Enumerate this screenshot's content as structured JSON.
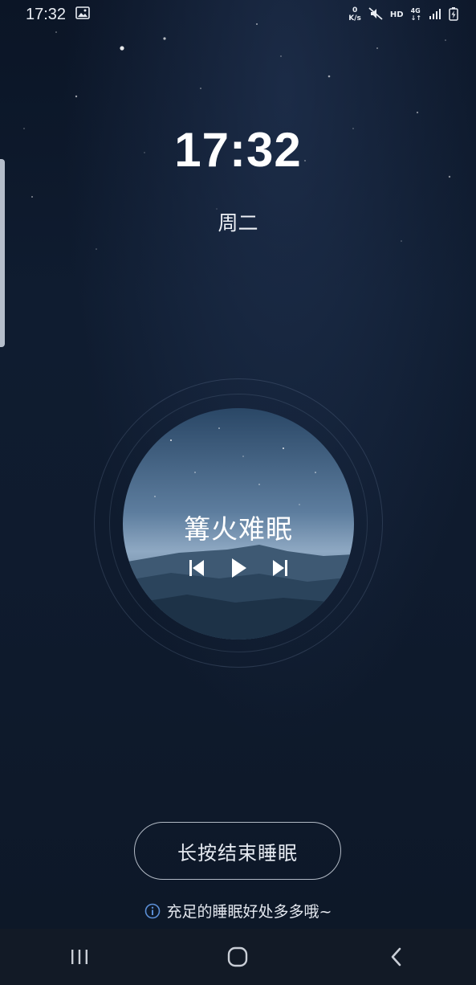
{
  "status_bar": {
    "time": "17:32",
    "net_speed_value": "0",
    "net_speed_unit": "K/s",
    "hd": "HD",
    "network": "4G",
    "icons": [
      "image-icon",
      "mute-icon",
      "signal-icon",
      "battery-charging-icon"
    ]
  },
  "clock": {
    "time": "17:32",
    "weekday": "周二"
  },
  "player": {
    "track_title": "篝火难眠",
    "controls": [
      "previous-icon",
      "play-icon",
      "next-icon"
    ]
  },
  "end_sleep_button": {
    "label": "长按结束睡眠"
  },
  "tip": {
    "icon": "info-icon",
    "text": "充足的睡眠好处多多哦~"
  },
  "nav_bar": {
    "buttons": [
      "recent-apps-icon",
      "home-icon",
      "back-icon"
    ]
  },
  "colors": {
    "background": "#0f1a2c",
    "accent_info": "#5b8fd6",
    "nav_bar": "#121a26"
  }
}
